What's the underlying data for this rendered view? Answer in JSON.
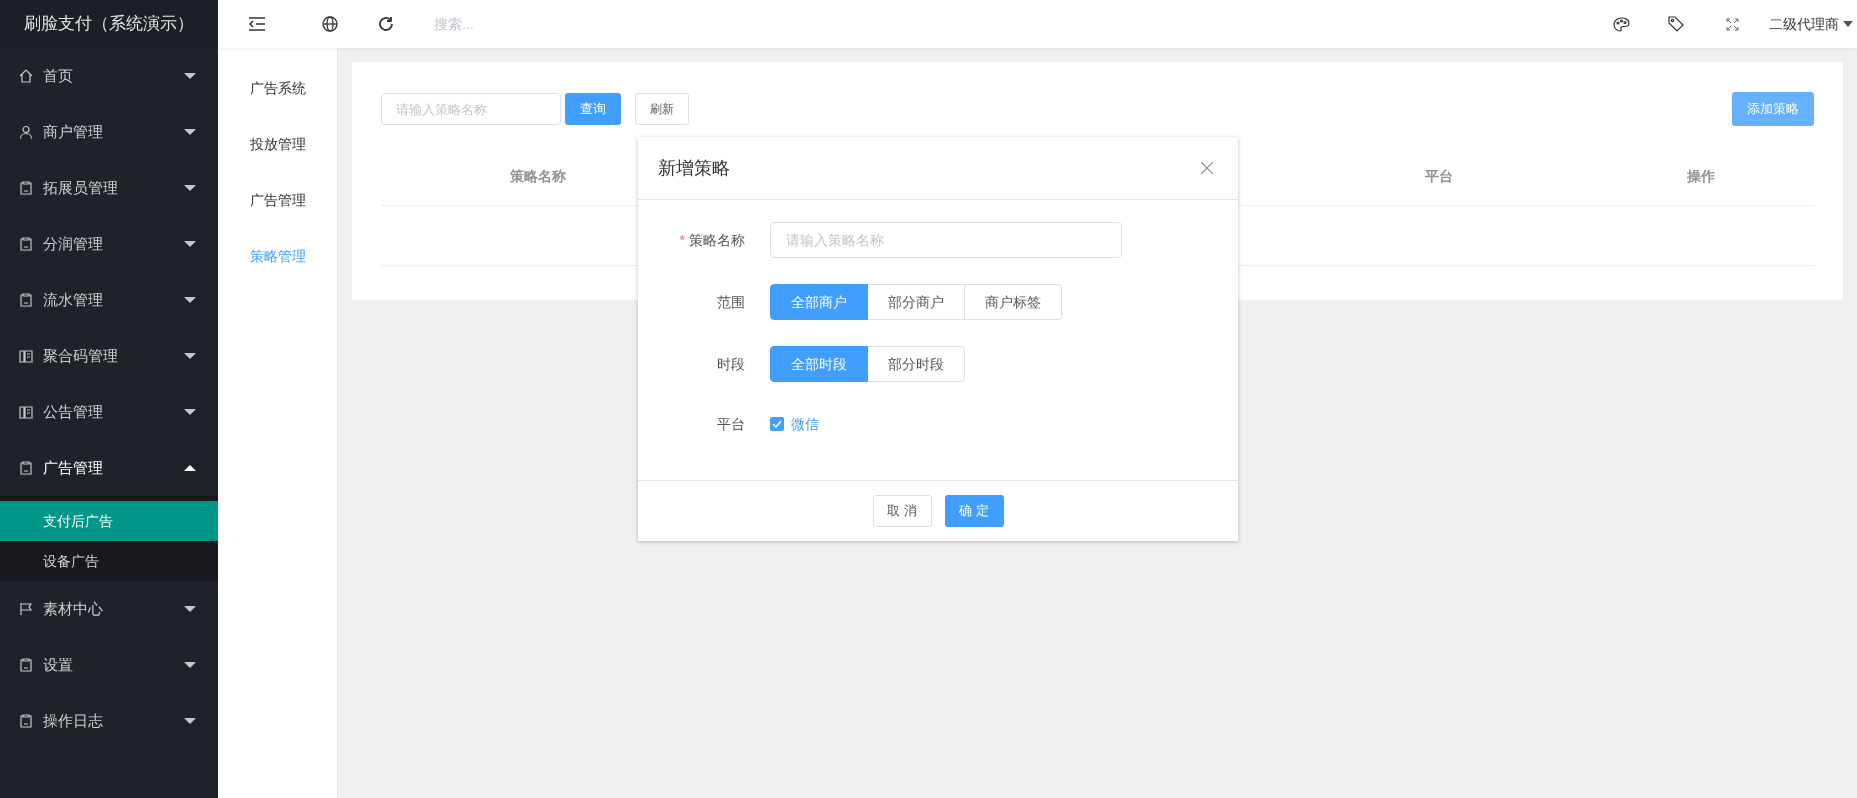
{
  "app_title": "刷脸支付（系统演示）",
  "header": {
    "search_placeholder": "搜索...",
    "user": "二级代理商"
  },
  "sidebar": {
    "items": [
      {
        "label": "首页",
        "expanded": false
      },
      {
        "label": "商户管理",
        "expanded": false
      },
      {
        "label": "拓展员管理",
        "expanded": false
      },
      {
        "label": "分润管理",
        "expanded": false
      },
      {
        "label": "流水管理",
        "expanded": false
      },
      {
        "label": "聚合码管理",
        "expanded": false
      },
      {
        "label": "公告管理",
        "expanded": false
      },
      {
        "label": "广告管理",
        "expanded": true,
        "children": [
          {
            "label": "支付后广告",
            "selected": true
          },
          {
            "label": "设备广告",
            "selected": false
          }
        ]
      },
      {
        "label": "素材中心",
        "expanded": false
      },
      {
        "label": "设置",
        "expanded": false
      },
      {
        "label": "操作日志",
        "expanded": false
      }
    ]
  },
  "subnav": [
    {
      "label": "广告系统",
      "selected": false
    },
    {
      "label": "投放管理",
      "selected": false
    },
    {
      "label": "广告管理",
      "selected": false
    },
    {
      "label": "策略管理",
      "selected": true
    }
  ],
  "toolbar": {
    "search_placeholder": "请输入策略名称",
    "query_button": "查询",
    "refresh_button": "刷新",
    "add_button": "添加策略"
  },
  "table": {
    "columns": [
      "策略名称",
      "平台",
      "操作"
    ]
  },
  "dialog": {
    "title": "新增策略",
    "name_field": {
      "required_mark": "*",
      "label": "策略名称",
      "placeholder": "请输入策略名称"
    },
    "scope": {
      "label": "范围",
      "options": [
        {
          "label": "全部商户",
          "selected": true
        },
        {
          "label": "部分商户",
          "selected": false
        },
        {
          "label": "商户标签",
          "selected": false
        }
      ]
    },
    "period": {
      "label": "时段",
      "options": [
        {
          "label": "全部时段",
          "selected": true
        },
        {
          "label": "部分时段",
          "selected": false
        }
      ]
    },
    "platform": {
      "label": "平台",
      "option": "微信",
      "checked": true
    },
    "cancel": "取 消",
    "confirm": "确 定"
  }
}
